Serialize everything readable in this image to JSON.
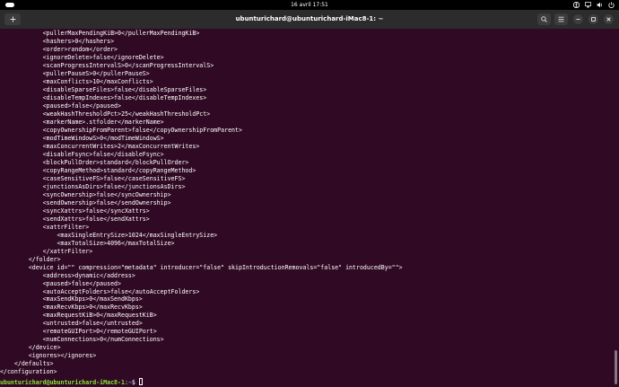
{
  "topbar": {
    "clock": "16 avril   17:51"
  },
  "window": {
    "title": "ubunturichard@ubunturichard-iMac8-1: ~"
  },
  "icons": {
    "new_tab": "new-tab-icon",
    "search": "search-icon",
    "menu": "hamburger-menu-icon",
    "minimize": "minimize-icon",
    "maximize": "maximize-icon",
    "close": "close-icon",
    "tray": [
      "accessibility-icon",
      "network-icon",
      "volume-icon",
      "power-icon"
    ]
  },
  "terminal": {
    "lines": [
      "            <pullerMaxPendingKiB>0</pullerMaxPendingKiB>",
      "            <hashers>0</hashers>",
      "            <order>random</order>",
      "            <ignoreDelete>false</ignoreDelete>",
      "            <scanProgressIntervalS>0</scanProgressIntervalS>",
      "            <pullerPauseS>0</pullerPauseS>",
      "            <maxConflicts>10</maxConflicts>",
      "            <disableSparseFiles>false</disableSparseFiles>",
      "            <disableTempIndexes>false</disableTempIndexes>",
      "            <paused>false</paused>",
      "            <weakHashThresholdPct>25</weakHashThresholdPct>",
      "            <markerName>.stfolder</markerName>",
      "            <copyOwnershipFromParent>false</copyOwnershipFromParent>",
      "            <modTimeWindowS>0</modTimeWindowS>",
      "            <maxConcurrentWrites>2</maxConcurrentWrites>",
      "            <disableFsync>false</disableFsync>",
      "            <blockPullOrder>standard</blockPullOrder>",
      "            <copyRangeMethod>standard</copyRangeMethod>",
      "            <caseSensitiveFS>false</caseSensitiveFS>",
      "            <junctionsAsDirs>false</junctionsAsDirs>",
      "            <syncOwnership>false</syncOwnership>",
      "            <sendOwnership>false</sendOwnership>",
      "            <syncXattrs>false</syncXattrs>",
      "            <sendXattrs>false</sendXattrs>",
      "            <xattrFilter>",
      "                <maxSingleEntrySize>1024</maxSingleEntrySize>",
      "                <maxTotalSize>4096</maxTotalSize>",
      "            </xattrFilter>",
      "        </folder>",
      "        <device id=\"\" compression=\"metadata\" introducer=\"false\" skipIntroductionRemovals=\"false\" introducedBy=\"\">",
      "            <address>dynamic</address>",
      "            <paused>false</paused>",
      "            <autoAcceptFolders>false</autoAcceptFolders>",
      "            <maxSendKbps>0</maxSendKbps>",
      "            <maxRecvKbps>0</maxRecvKbps>",
      "            <maxRequestKiB>0</maxRequestKiB>",
      "            <untrusted>false</untrusted>",
      "            <remoteGUIPort>0</remoteGUIPort>",
      "            <numConnections>0</numConnections>",
      "        </device>",
      "        <ignores></ignores>",
      "    </defaults>",
      "</configuration>"
    ],
    "prompt": {
      "user_host": "ubunturichard@ubunturichard-iMac8-1",
      "separator": ":",
      "path": "~",
      "symbol": "$ "
    }
  }
}
